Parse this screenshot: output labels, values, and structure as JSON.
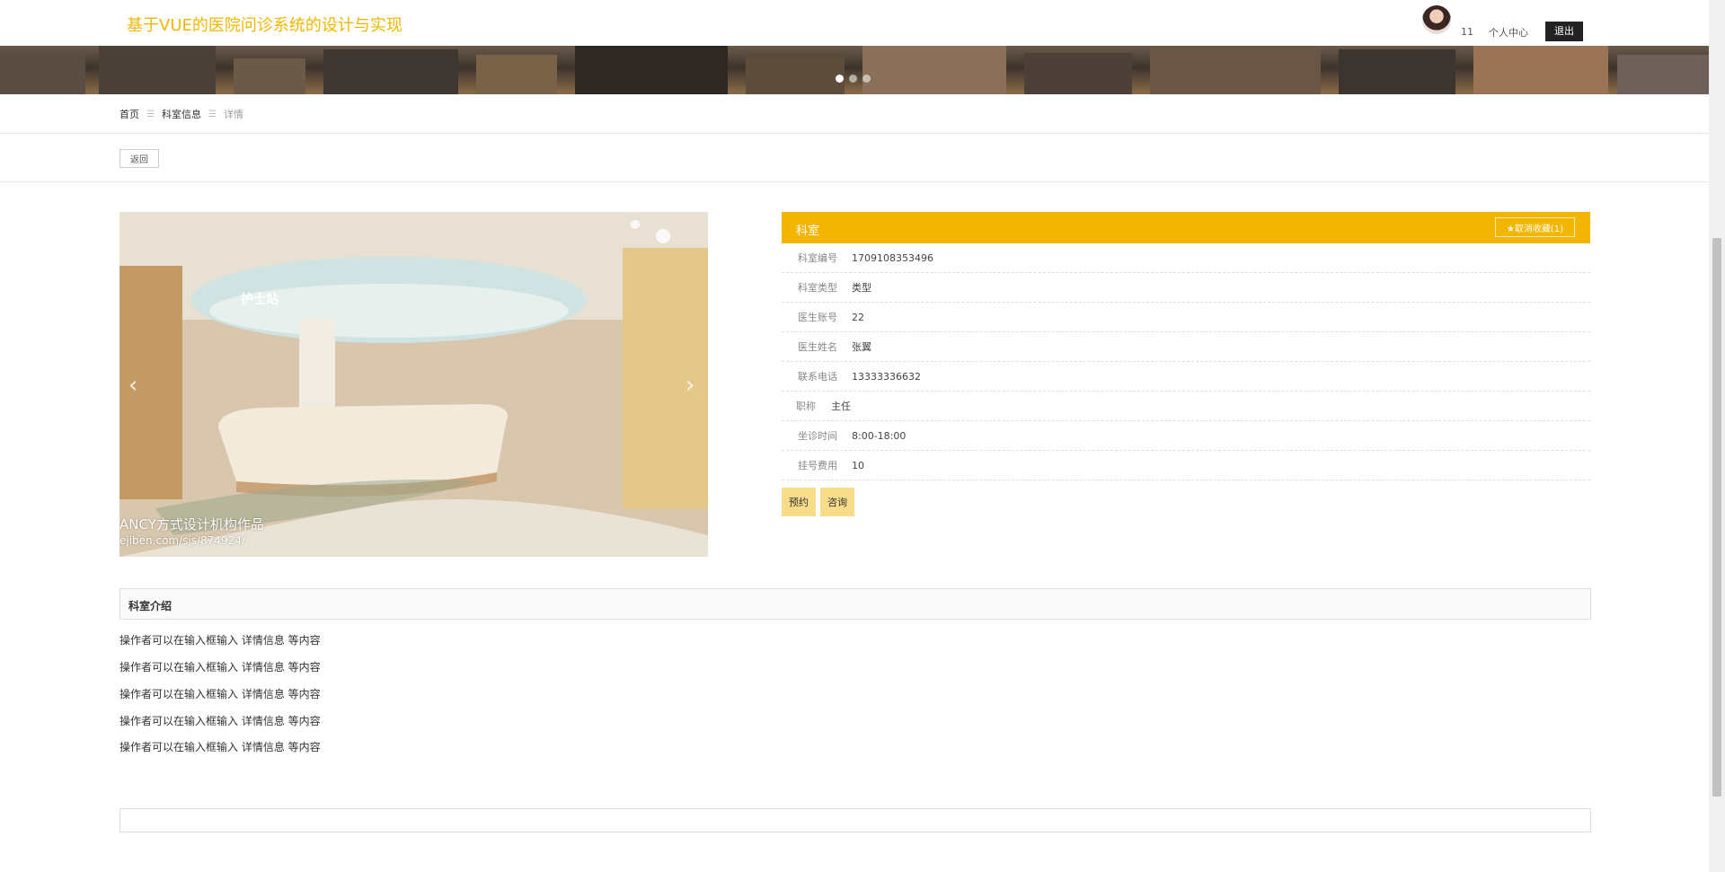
{
  "header": {
    "site_title": "基于VUE的医院问诊系统的设计与实现",
    "user_name": "11",
    "user_center": "个人中心",
    "logout": "退出"
  },
  "banner": {
    "slide_count": 3,
    "active_slide": 1
  },
  "breadcrumb": {
    "home": "首页",
    "section": "科室信息",
    "current": "详情"
  },
  "back_button": "返回",
  "photo": {
    "prev_icon": "chevron-left-icon",
    "next_icon": "chevron-right-icon",
    "sign_text": "护士站",
    "watermark_line1": "ANCY方式设计机构作品",
    "watermark_line2": "ejiben.com/sjs/874924/"
  },
  "detail": {
    "title": "科室",
    "favorite_button": "★取消收藏(1)",
    "fields": [
      {
        "label": "科室编号",
        "value": "1709108353496"
      },
      {
        "label": "科室类型",
        "value": "类型"
      },
      {
        "label": "医生账号",
        "value": "22"
      },
      {
        "label": "医生姓名",
        "value": "张翼"
      },
      {
        "label": "联系电话",
        "value": "13333336632"
      },
      {
        "label": "职称",
        "value": "主任"
      },
      {
        "label": "坐诊时间",
        "value": "8:00-18:00"
      },
      {
        "label": "挂号费用",
        "value": "10"
      }
    ],
    "actions": {
      "book": "预约",
      "consult": "咨询"
    }
  },
  "intro": {
    "title": "科室介绍",
    "paragraphs": [
      "操作者可以在输入框输入  详情信息  等内容",
      "操作者可以在输入框输入  详情信息  等内容",
      "操作者可以在输入框输入  详情信息  等内容",
      "操作者可以在输入框输入  详情信息  等内容",
      "操作者可以在输入框输入  详情信息  等内容"
    ]
  },
  "colors": {
    "accent": "#f3b600",
    "action_bg": "#f7dc8a",
    "logout_bg": "#222222"
  }
}
